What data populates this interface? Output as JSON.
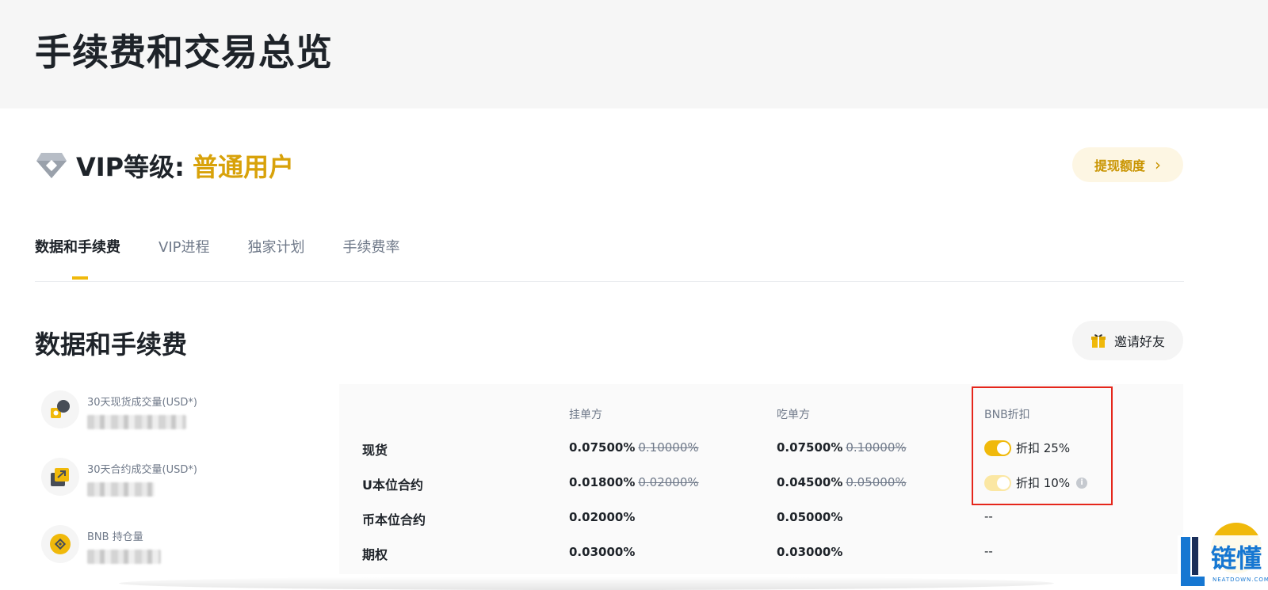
{
  "page": {
    "title": "手续费和交易总览"
  },
  "vip": {
    "label": "VIP等级:",
    "level": "普通用户"
  },
  "withdraw": {
    "label": "提现额度",
    "chevron": "›"
  },
  "tabs": [
    {
      "label": "数据和手续费",
      "active": true
    },
    {
      "label": "VIP进程",
      "active": false
    },
    {
      "label": "独家计划",
      "active": false
    },
    {
      "label": "手续费率",
      "active": false
    }
  ],
  "section": {
    "title": "数据和手续费"
  },
  "invite": {
    "label": "邀请好友",
    "icon": "gift-icon"
  },
  "stats": [
    {
      "label": "30天现货成交量(USD*)",
      "icon": "spot-volume-icon",
      "value_hidden": true
    },
    {
      "label": "30天合约成交量(USD*)",
      "icon": "futures-volume-icon",
      "value_hidden": true
    },
    {
      "label": "BNB 持仓量",
      "icon": "bnb-icon",
      "value_hidden": true
    }
  ],
  "fee_table": {
    "headers": {
      "maker": "挂单方",
      "taker": "吃单方",
      "bnb": "BNB折扣"
    },
    "rows": [
      {
        "name": "现货",
        "maker": "0.07500%",
        "maker_old": "0.10000%",
        "taker": "0.07500%",
        "taker_old": "0.10000%",
        "bnb": "折扣 25%",
        "toggle_on": true
      },
      {
        "name": "U本位合约",
        "maker": "0.01800%",
        "maker_old": "0.02000%",
        "taker": "0.04500%",
        "taker_old": "0.05000%",
        "bnb": "折扣 10%",
        "toggle_on": true,
        "info": "i"
      },
      {
        "name": "币本位合约",
        "maker": "0.02000%",
        "taker": "0.05000%",
        "bnb": "--"
      },
      {
        "name": "期权",
        "maker": "0.03000%",
        "taker": "0.03000%",
        "bnb": "--"
      }
    ]
  },
  "colors": {
    "accent": "#f0b90b",
    "gold_text": "#d8a20a",
    "highlight": "#e5261b"
  },
  "watermark": {
    "text": "链懂",
    "sub": "NEATDOWN.COM"
  }
}
